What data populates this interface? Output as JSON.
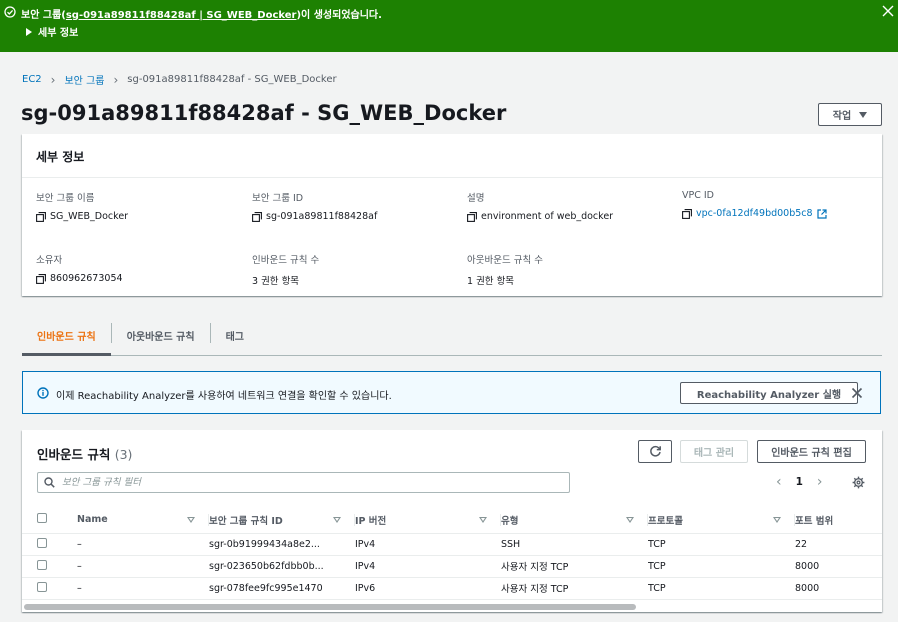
{
  "flash": {
    "prefix": "보안 그룹(",
    "link": "sg-091a89811f88428af | SG_WEB_Docker",
    "suffix": ")이 생성되었습니다.",
    "details_label": "세부 정보"
  },
  "breadcrumb": {
    "items": [
      "EC2",
      "보안 그룹"
    ],
    "current": "sg-091a89811f88428af - SG_WEB_Docker"
  },
  "page_title": "sg-091a89811f88428af - SG_WEB_Docker",
  "actions_label": "작업",
  "details": {
    "header": "세부 정보",
    "fields": [
      {
        "label": "보안 그룹 이름",
        "value": "SG_WEB_Docker"
      },
      {
        "label": "보안 그룹 ID",
        "value": "sg-091a89811f88428af"
      },
      {
        "label": "설명",
        "value": "environment of web_docker"
      },
      {
        "label": "VPC ID",
        "value": "vpc-0fa12df49bd00b5c8"
      },
      {
        "label": "소유자",
        "value": "860962673054"
      },
      {
        "label": "인바운드 규칙 수",
        "value": "3 권한 항목"
      },
      {
        "label": "아웃바운드 규칙 수",
        "value": "1 권한 항목"
      }
    ]
  },
  "tabs": [
    "인바운드 규칙",
    "아웃바운드 규칙",
    "태그"
  ],
  "alert": {
    "text": "이제 Reachability Analyzer를 사용하여 네트워크 연결을 확인할 수 있습니다.",
    "button": "Reachability Analyzer 실행"
  },
  "rules": {
    "title": "인바운드 규칙",
    "count": "(3)",
    "tag_button": "태그 관리",
    "edit_button": "인바운드 규칙 편집",
    "filter_placeholder": "보안 그룹 규칙 필터",
    "page": "1",
    "columns": [
      "Name",
      "보안 그룹 규칙 ID",
      "IP 버전",
      "유형",
      "프로토콜",
      "포트 범위"
    ],
    "rows": [
      {
        "name": "–",
        "id": "sgr-0b91999434a8e2...",
        "ip": "IPv4",
        "type": "SSH",
        "protocol": "TCP",
        "port": "22"
      },
      {
        "name": "–",
        "id": "sgr-023650b62fdbb0b...",
        "ip": "IPv4",
        "type": "사용자 지정 TCP",
        "protocol": "TCP",
        "port": "8000"
      },
      {
        "name": "–",
        "id": "sgr-078fee9fc995e1470",
        "ip": "IPv6",
        "type": "사용자 지정 TCP",
        "protocol": "TCP",
        "port": "8000"
      }
    ]
  },
  "colors": {
    "success": "#1d8102",
    "link": "#0073bb",
    "accent": "#ec7211"
  }
}
